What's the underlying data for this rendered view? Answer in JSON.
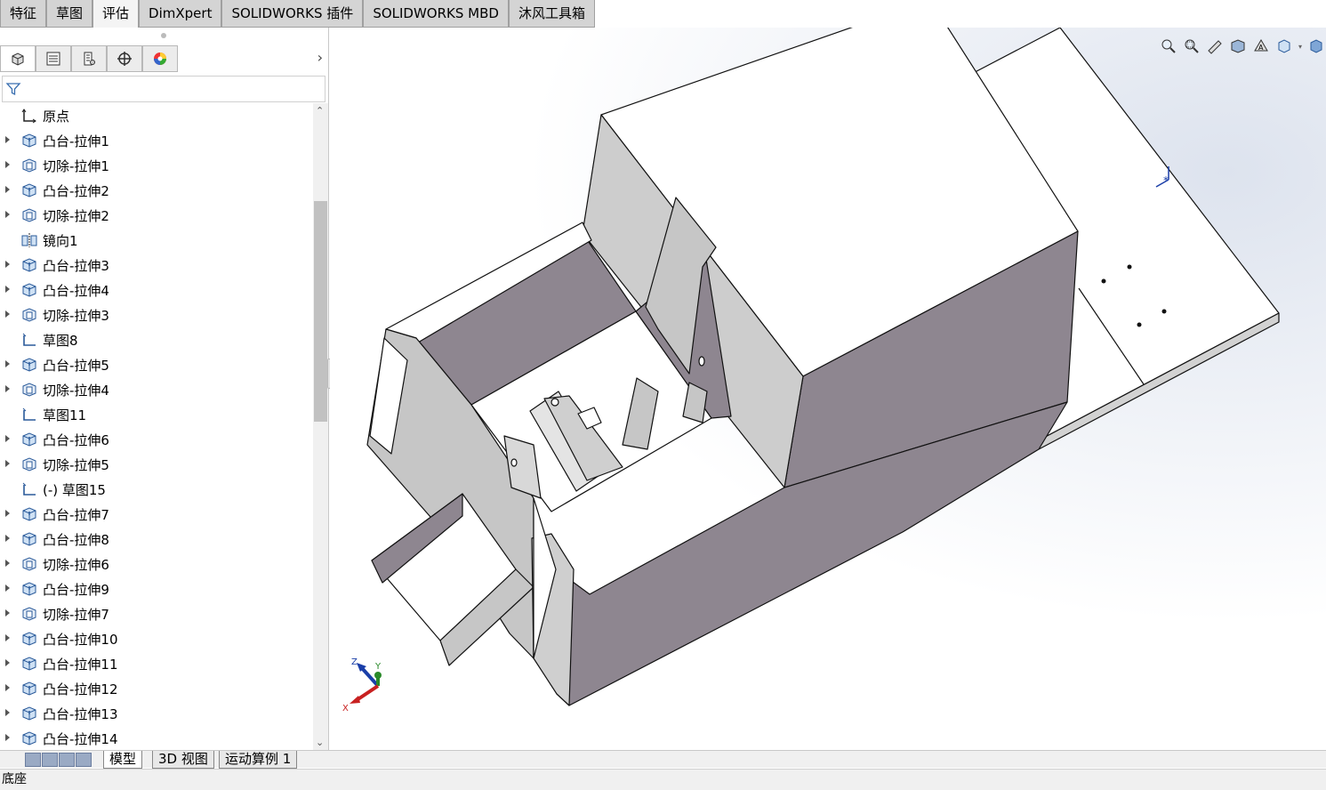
{
  "command_tabs": [
    "特征",
    "草图",
    "评估",
    "DimXpert",
    "SOLIDWORKS 插件",
    "SOLIDWORKS MBD",
    "沐风工具箱"
  ],
  "active_command_tab": "评估",
  "manager_tabs": [
    "featuremanager-icon",
    "propertymanager-icon",
    "configurationmanager-icon",
    "dimxpertmanager-icon",
    "displaymanager-icon"
  ],
  "tree": {
    "items": [
      {
        "label": "原点",
        "icon": "origin-icon",
        "expand": false
      },
      {
        "label": "凸台-拉伸1",
        "icon": "boss-extrude-icon",
        "expand": true
      },
      {
        "label": "切除-拉伸1",
        "icon": "cut-extrude-icon",
        "expand": true
      },
      {
        "label": "凸台-拉伸2",
        "icon": "boss-extrude-icon",
        "expand": true
      },
      {
        "label": "切除-拉伸2",
        "icon": "cut-extrude-icon",
        "expand": true
      },
      {
        "label": "镜向1",
        "icon": "mirror-icon",
        "expand": false
      },
      {
        "label": "凸台-拉伸3",
        "icon": "boss-extrude-icon",
        "expand": true
      },
      {
        "label": "凸台-拉伸4",
        "icon": "boss-extrude-icon",
        "expand": true
      },
      {
        "label": "切除-拉伸3",
        "icon": "cut-extrude-icon",
        "expand": true
      },
      {
        "label": "草图8",
        "icon": "sketch-icon",
        "expand": false
      },
      {
        "label": "凸台-拉伸5",
        "icon": "boss-extrude-icon",
        "expand": true
      },
      {
        "label": "切除-拉伸4",
        "icon": "cut-extrude-icon",
        "expand": true
      },
      {
        "label": "草图11",
        "icon": "sketch-icon",
        "expand": false
      },
      {
        "label": "凸台-拉伸6",
        "icon": "boss-extrude-icon",
        "expand": true
      },
      {
        "label": "切除-拉伸5",
        "icon": "cut-extrude-icon",
        "expand": true
      },
      {
        "label": "(-) 草图15",
        "icon": "sketch-icon",
        "expand": false
      },
      {
        "label": "凸台-拉伸7",
        "icon": "boss-extrude-icon",
        "expand": true
      },
      {
        "label": "凸台-拉伸8",
        "icon": "boss-extrude-icon",
        "expand": true
      },
      {
        "label": "切除-拉伸6",
        "icon": "cut-extrude-icon",
        "expand": true
      },
      {
        "label": "凸台-拉伸9",
        "icon": "boss-extrude-icon",
        "expand": true
      },
      {
        "label": "切除-拉伸7",
        "icon": "cut-extrude-icon",
        "expand": true
      },
      {
        "label": "凸台-拉伸10",
        "icon": "boss-extrude-icon",
        "expand": true
      },
      {
        "label": "凸台-拉伸11",
        "icon": "boss-extrude-icon",
        "expand": true
      },
      {
        "label": "凸台-拉伸12",
        "icon": "boss-extrude-icon",
        "expand": true
      },
      {
        "label": "凸台-拉伸13",
        "icon": "boss-extrude-icon",
        "expand": true
      },
      {
        "label": "凸台-拉伸14",
        "icon": "boss-extrude-icon",
        "expand": true
      }
    ]
  },
  "bottom_tabs": [
    "模型",
    "3D 视图",
    "运动算例 1"
  ],
  "active_bottom_tab": "模型",
  "status_text": "底座",
  "triad": {
    "x": "X",
    "y": "Y",
    "z": "Z"
  },
  "heads_up_toolbar": [
    "zoom-to-fit-icon",
    "zoom-to-area-icon",
    "previous-view-icon",
    "section-view-icon",
    "dynamic-annotation-icon",
    "view-orientation-icon",
    "display-style-icon",
    "hide-show-items-icon",
    "edit-appearance-icon",
    "apply-scene-icon",
    "view-settings-icon"
  ],
  "colors": {
    "model_face": "#8e8690",
    "model_light": "#ffffff",
    "model_mid": "#c8c8c8",
    "accent_blue": "#1a3ea8"
  }
}
